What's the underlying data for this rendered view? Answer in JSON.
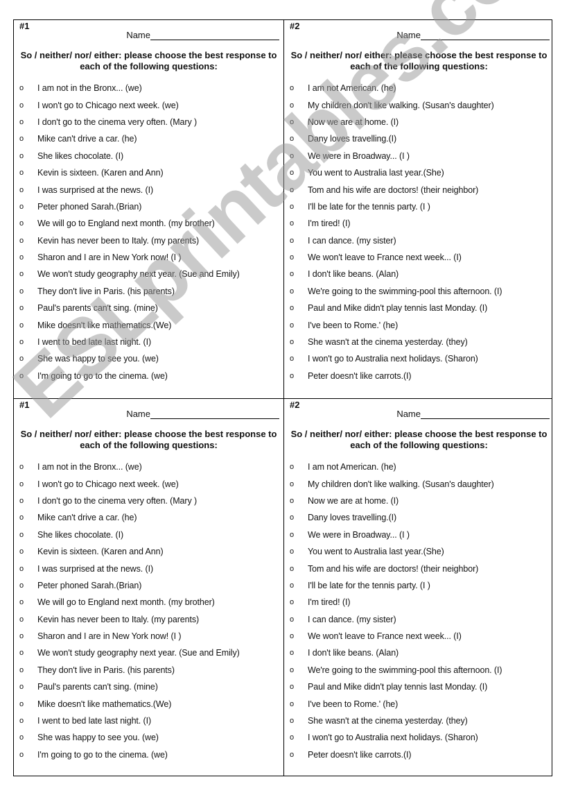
{
  "cards": [
    {
      "number": "#1",
      "name_label": "Name",
      "instructions": "So / neither/ nor/ either: please choose the best response to each of the following questions:",
      "bullet": "o",
      "items": [
        "I am not in the Bronx... (we)",
        "I won't go to Chicago next week. (we)",
        "I don't go to the cinema very often. (Mary )",
        "Mike can't drive a car. (he)",
        "She likes chocolate. (I)",
        "Kevin is sixteen. (Karen and Ann)",
        "I was surprised at the news. (I)",
        "Peter phoned Sarah.(Brian)",
        "We will go to England next month. (my brother)",
        "Kevin has never been to Italy. (my parents)",
        "Sharon and I are in New York now! (I )",
        "We won't study geography next year. (Sue and Emily)",
        "They don't live in Paris. (his parents)",
        "Paul's parents can't sing. (mine)",
        "Mike doesn't like mathematics.(We)",
        "I went to bed late last night. (I)",
        "She was happy to see you. (we)",
        "I'm going to go to the cinema. (we)"
      ]
    },
    {
      "number": "#2",
      "name_label": "Name",
      "instructions": "So / neither/ nor/ either: please choose the best response to each of the following questions:",
      "bullet": "o",
      "items": [
        "I am not American. (he)",
        "My children don't like walking. (Susan's daughter)",
        "Now we are at home. (I)",
        "Dany loves travelling.(I)",
        "We were in Broadway...  (I )",
        "You went to Australia last year.(She)",
        "Tom and his wife are doctors! (their neighbor)",
        "I'll be late for the tennis party. (I )",
        "I'm tired! (I)",
        "I can dance. (my sister)",
        "We won't leave to France next week... (I)",
        "I don't like beans. (Alan)",
        "We're going to the swimming-pool this afternoon. (I)",
        "Paul and Mike didn't play tennis last Monday. (I)",
        "I've been to Rome.' (he)",
        "She wasn't at the cinema yesterday. (they)",
        "I won't go to Australia next holidays. (Sharon)",
        "Peter doesn't like carrots.(I)"
      ]
    }
  ],
  "watermark": "ESLprintables.com"
}
